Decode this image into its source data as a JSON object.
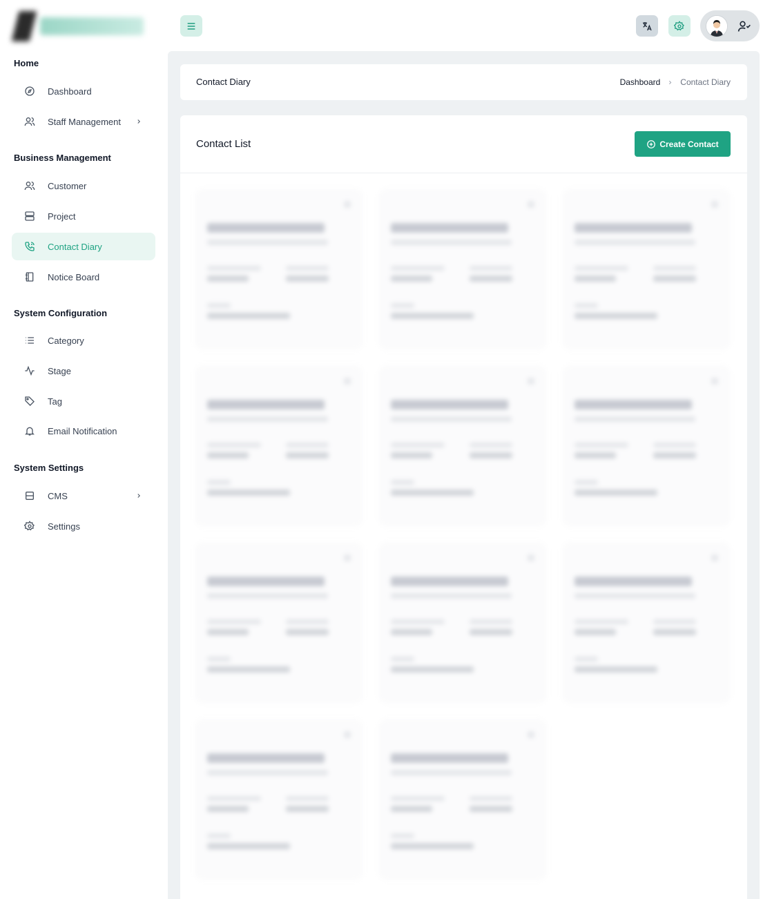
{
  "sidebar": {
    "sections": [
      {
        "title": "Home",
        "items": [
          {
            "label": "Dashboard",
            "icon": "compass-icon",
            "has_chevron": false,
            "active": false
          },
          {
            "label": "Staff Management",
            "icon": "users-icon",
            "has_chevron": true,
            "active": false
          }
        ]
      },
      {
        "title": "Business Management",
        "items": [
          {
            "label": "Customer",
            "icon": "users-icon",
            "has_chevron": false,
            "active": false
          },
          {
            "label": "Project",
            "icon": "server-icon",
            "has_chevron": false,
            "active": false
          },
          {
            "label": "Contact Diary",
            "icon": "phone-icon",
            "has_chevron": false,
            "active": true
          },
          {
            "label": "Notice Board",
            "icon": "notebook-icon",
            "has_chevron": false,
            "active": false
          }
        ]
      },
      {
        "title": "System Configuration",
        "items": [
          {
            "label": "Category",
            "icon": "list-icon",
            "has_chevron": false,
            "active": false
          },
          {
            "label": "Stage",
            "icon": "activity-icon",
            "has_chevron": false,
            "active": false
          },
          {
            "label": "Tag",
            "icon": "tag-icon",
            "has_chevron": false,
            "active": false
          },
          {
            "label": "Email Notification",
            "icon": "bell-icon",
            "has_chevron": false,
            "active": false
          }
        ]
      },
      {
        "title": "System Settings",
        "items": [
          {
            "label": "CMS",
            "icon": "layout-icon",
            "has_chevron": true,
            "active": false
          },
          {
            "label": "Settings",
            "icon": "gear-icon",
            "has_chevron": false,
            "active": false
          }
        ]
      }
    ]
  },
  "header": {
    "page_title": "Contact Diary",
    "breadcrumb": {
      "link": "Dashboard",
      "current": "Contact Diary"
    }
  },
  "contact_list": {
    "title": "Contact List",
    "create_label": "Create Contact"
  },
  "colors": {
    "accent": "#1fa383",
    "accent_light": "#e9f6f2"
  }
}
